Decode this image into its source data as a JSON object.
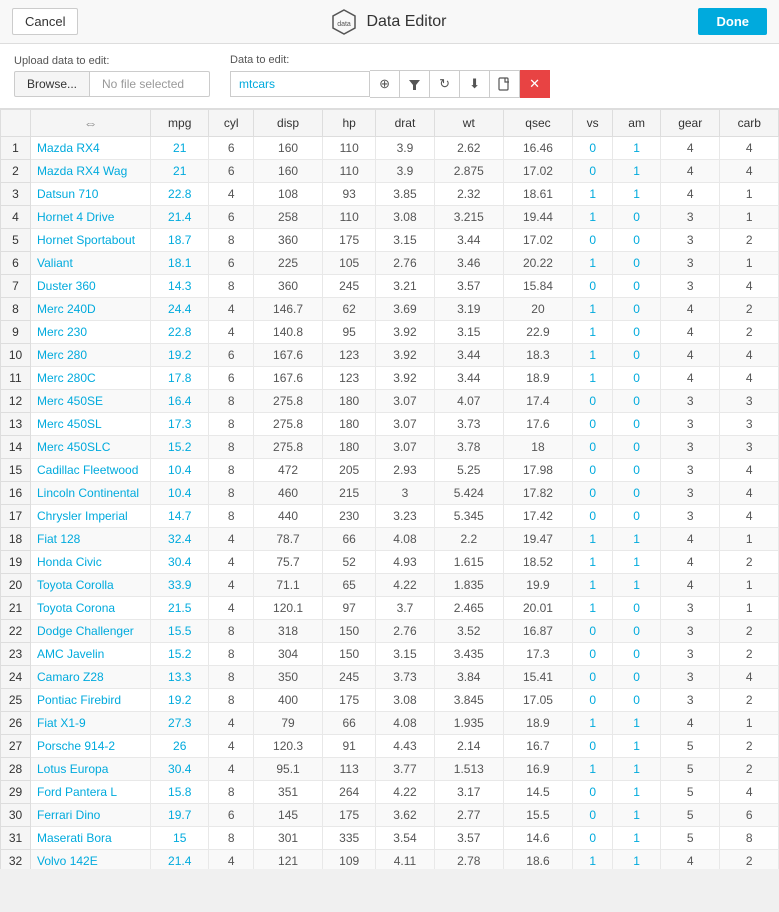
{
  "header": {
    "title": "Data Editor",
    "cancel_label": "Cancel",
    "done_label": "Done"
  },
  "upload": {
    "upload_label": "Upload data to edit:",
    "browse_label": "Browse...",
    "no_file_text": "No file selected",
    "data_edit_label": "Data to edit:",
    "data_input_value": "mtcars"
  },
  "icons": {
    "target": "⊕",
    "filter": "▼",
    "refresh": "↻",
    "download": "⬇",
    "file": "📄",
    "close": "✕"
  },
  "table": {
    "columns": [
      "",
      "mpg",
      "cyl",
      "disp",
      "hp",
      "drat",
      "wt",
      "qsec",
      "vs",
      "am",
      "gear",
      "carb"
    ],
    "rows": [
      [
        1,
        "Mazda RX4",
        21,
        6,
        160,
        110,
        3.9,
        2.62,
        16.46,
        0,
        1,
        4,
        4
      ],
      [
        2,
        "Mazda RX4 Wag",
        21,
        6,
        160,
        110,
        3.9,
        2.875,
        17.02,
        0,
        1,
        4,
        4
      ],
      [
        3,
        "Datsun 710",
        22.8,
        4,
        108,
        93,
        3.85,
        2.32,
        18.61,
        1,
        1,
        4,
        1
      ],
      [
        4,
        "Hornet 4 Drive",
        21.4,
        6,
        258,
        110,
        3.08,
        3.215,
        19.44,
        1,
        0,
        3,
        1
      ],
      [
        5,
        "Hornet Sportabout",
        18.7,
        8,
        360,
        175,
        3.15,
        3.44,
        17.02,
        0,
        0,
        3,
        2
      ],
      [
        6,
        "Valiant",
        18.1,
        6,
        225,
        105,
        2.76,
        3.46,
        20.22,
        1,
        0,
        3,
        1
      ],
      [
        7,
        "Duster 360",
        14.3,
        8,
        360,
        245,
        3.21,
        3.57,
        15.84,
        0,
        0,
        3,
        4
      ],
      [
        8,
        "Merc 240D",
        24.4,
        4,
        146.7,
        62,
        3.69,
        3.19,
        20,
        1,
        0,
        4,
        2
      ],
      [
        9,
        "Merc 230",
        22.8,
        4,
        140.8,
        95,
        3.92,
        3.15,
        22.9,
        1,
        0,
        4,
        2
      ],
      [
        10,
        "Merc 280",
        19.2,
        6,
        167.6,
        123,
        3.92,
        3.44,
        18.3,
        1,
        0,
        4,
        4
      ],
      [
        11,
        "Merc 280C",
        17.8,
        6,
        167.6,
        123,
        3.92,
        3.44,
        18.9,
        1,
        0,
        4,
        4
      ],
      [
        12,
        "Merc 450SE",
        16.4,
        8,
        275.8,
        180,
        3.07,
        4.07,
        17.4,
        0,
        0,
        3,
        3
      ],
      [
        13,
        "Merc 450SL",
        17.3,
        8,
        275.8,
        180,
        3.07,
        3.73,
        17.6,
        0,
        0,
        3,
        3
      ],
      [
        14,
        "Merc 450SLC",
        15.2,
        8,
        275.8,
        180,
        3.07,
        3.78,
        18,
        0,
        0,
        3,
        3
      ],
      [
        15,
        "Cadillac Fleetwood",
        10.4,
        8,
        472,
        205,
        2.93,
        5.25,
        17.98,
        0,
        0,
        3,
        4
      ],
      [
        16,
        "Lincoln Continental",
        10.4,
        8,
        460,
        215,
        3,
        5.424,
        17.82,
        0,
        0,
        3,
        4
      ],
      [
        17,
        "Chrysler Imperial",
        14.7,
        8,
        440,
        230,
        3.23,
        5.345,
        17.42,
        0,
        0,
        3,
        4
      ],
      [
        18,
        "Fiat 128",
        32.4,
        4,
        78.7,
        66,
        4.08,
        2.2,
        19.47,
        1,
        1,
        4,
        1
      ],
      [
        19,
        "Honda Civic",
        30.4,
        4,
        75.7,
        52,
        4.93,
        1.615,
        18.52,
        1,
        1,
        4,
        2
      ],
      [
        20,
        "Toyota Corolla",
        33.9,
        4,
        71.1,
        65,
        4.22,
        1.835,
        19.9,
        1,
        1,
        4,
        1
      ],
      [
        21,
        "Toyota Corona",
        21.5,
        4,
        120.1,
        97,
        3.7,
        2.465,
        20.01,
        1,
        0,
        3,
        1
      ],
      [
        22,
        "Dodge Challenger",
        15.5,
        8,
        318,
        150,
        2.76,
        3.52,
        16.87,
        0,
        0,
        3,
        2
      ],
      [
        23,
        "AMC Javelin",
        15.2,
        8,
        304,
        150,
        3.15,
        3.435,
        17.3,
        0,
        0,
        3,
        2
      ],
      [
        24,
        "Camaro Z28",
        13.3,
        8,
        350,
        245,
        3.73,
        3.84,
        15.41,
        0,
        0,
        3,
        4
      ],
      [
        25,
        "Pontiac Firebird",
        19.2,
        8,
        400,
        175,
        3.08,
        3.845,
        17.05,
        0,
        0,
        3,
        2
      ],
      [
        26,
        "Fiat X1-9",
        27.3,
        4,
        79,
        66,
        4.08,
        1.935,
        18.9,
        1,
        1,
        4,
        1
      ],
      [
        27,
        "Porsche 914-2",
        26,
        4,
        120.3,
        91,
        4.43,
        2.14,
        16.7,
        0,
        1,
        5,
        2
      ],
      [
        28,
        "Lotus Europa",
        30.4,
        4,
        95.1,
        113,
        3.77,
        1.513,
        16.9,
        1,
        1,
        5,
        2
      ],
      [
        29,
        "Ford Pantera L",
        15.8,
        8,
        351,
        264,
        4.22,
        3.17,
        14.5,
        0,
        1,
        5,
        4
      ],
      [
        30,
        "Ferrari Dino",
        19.7,
        6,
        145,
        175,
        3.62,
        2.77,
        15.5,
        0,
        1,
        5,
        6
      ],
      [
        31,
        "Maserati Bora",
        15,
        8,
        301,
        335,
        3.54,
        3.57,
        14.6,
        0,
        1,
        5,
        8
      ],
      [
        32,
        "Volvo 142E",
        21.4,
        4,
        121,
        109,
        4.11,
        2.78,
        18.6,
        1,
        1,
        4,
        2
      ]
    ],
    "blue_cols": [
      1,
      9,
      10
    ]
  }
}
